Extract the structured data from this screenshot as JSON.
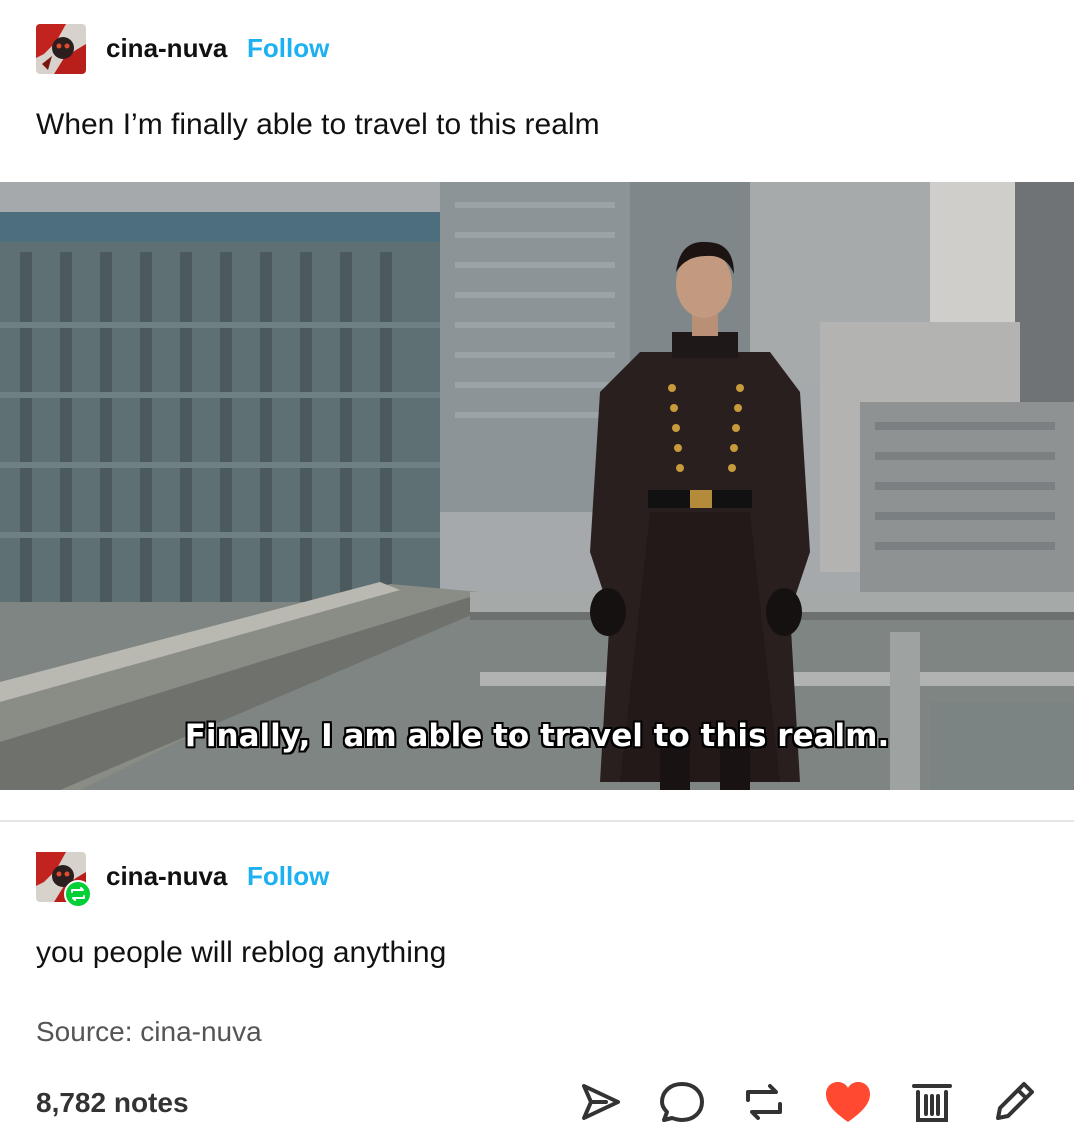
{
  "post": {
    "blogname": "cina-nuva",
    "follow_label": "Follow",
    "body": "When I’m finally able to travel to this realm",
    "image_caption": "Finally, I am able to travel to this realm."
  },
  "reblog": {
    "blogname": "cina-nuva",
    "follow_label": "Follow",
    "body": "you people will reblog anything"
  },
  "footer": {
    "source": "Source: cina-nuva",
    "notes": "8,782 notes",
    "actions": [
      "share-icon",
      "reply-icon",
      "reblog-icon",
      "like-icon",
      "delete-icon",
      "edit-icon"
    ]
  },
  "colors": {
    "accent": "#1db1f2",
    "like": "#ff4930",
    "reblog_badge": "#00cf35"
  }
}
